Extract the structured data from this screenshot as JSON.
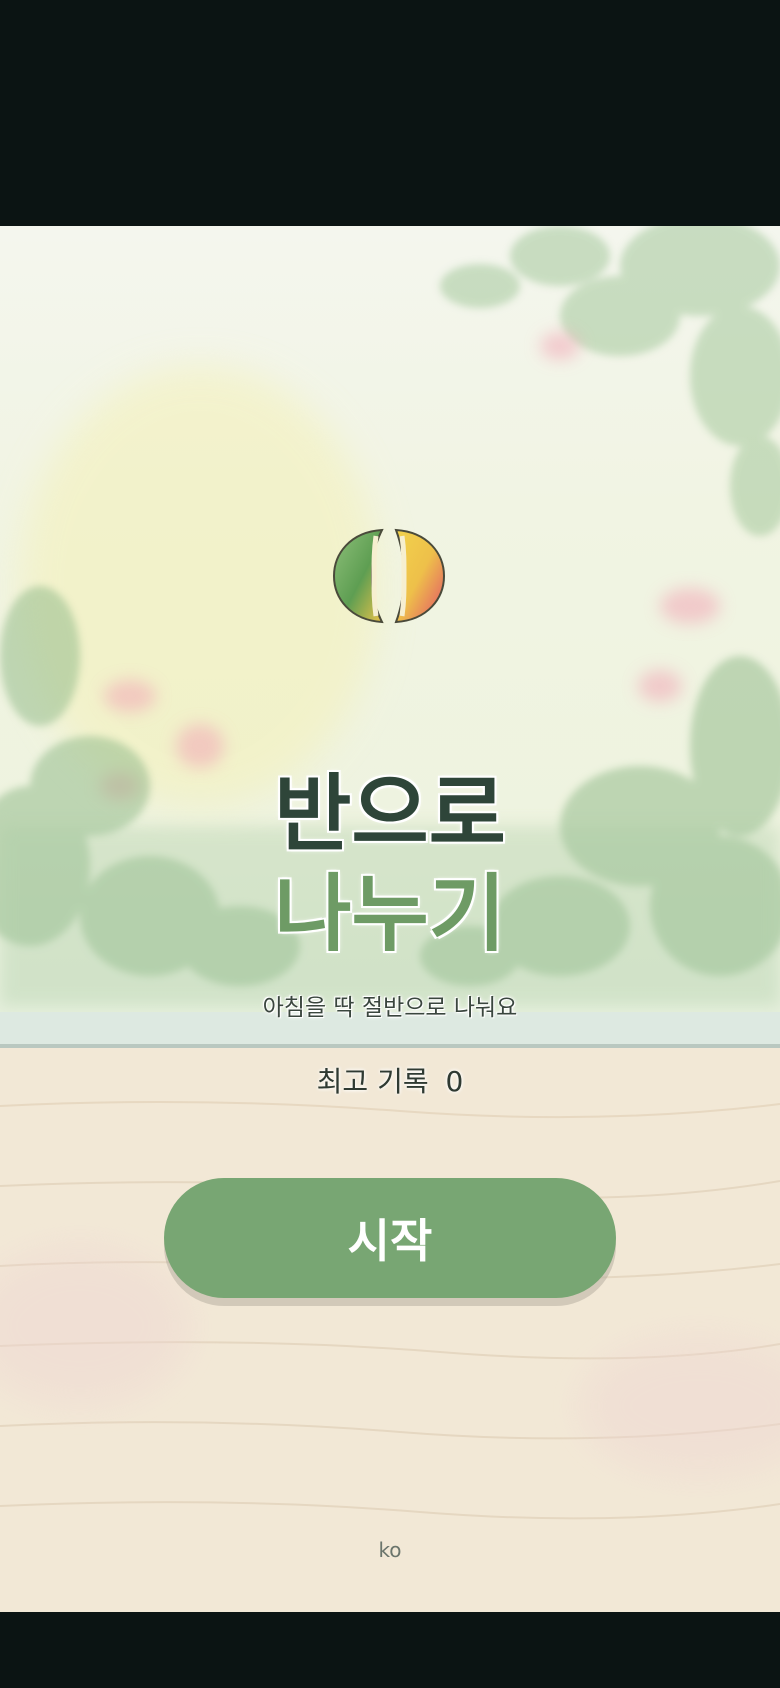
{
  "game": {
    "title_line1": "반으로",
    "title_line2": "나누기",
    "subtitle": "아침을 딱 절반으로 나눠요",
    "best_label": "최고 기록",
    "best_score": "0",
    "start_label": "시작",
    "language": "ko"
  },
  "colors": {
    "title_dark": "#2e4539",
    "title_green": "#6e9b65",
    "button": "#78a673",
    "letterbox": "#0b1413"
  },
  "icons": {
    "logo": "split-fruit-logo"
  }
}
